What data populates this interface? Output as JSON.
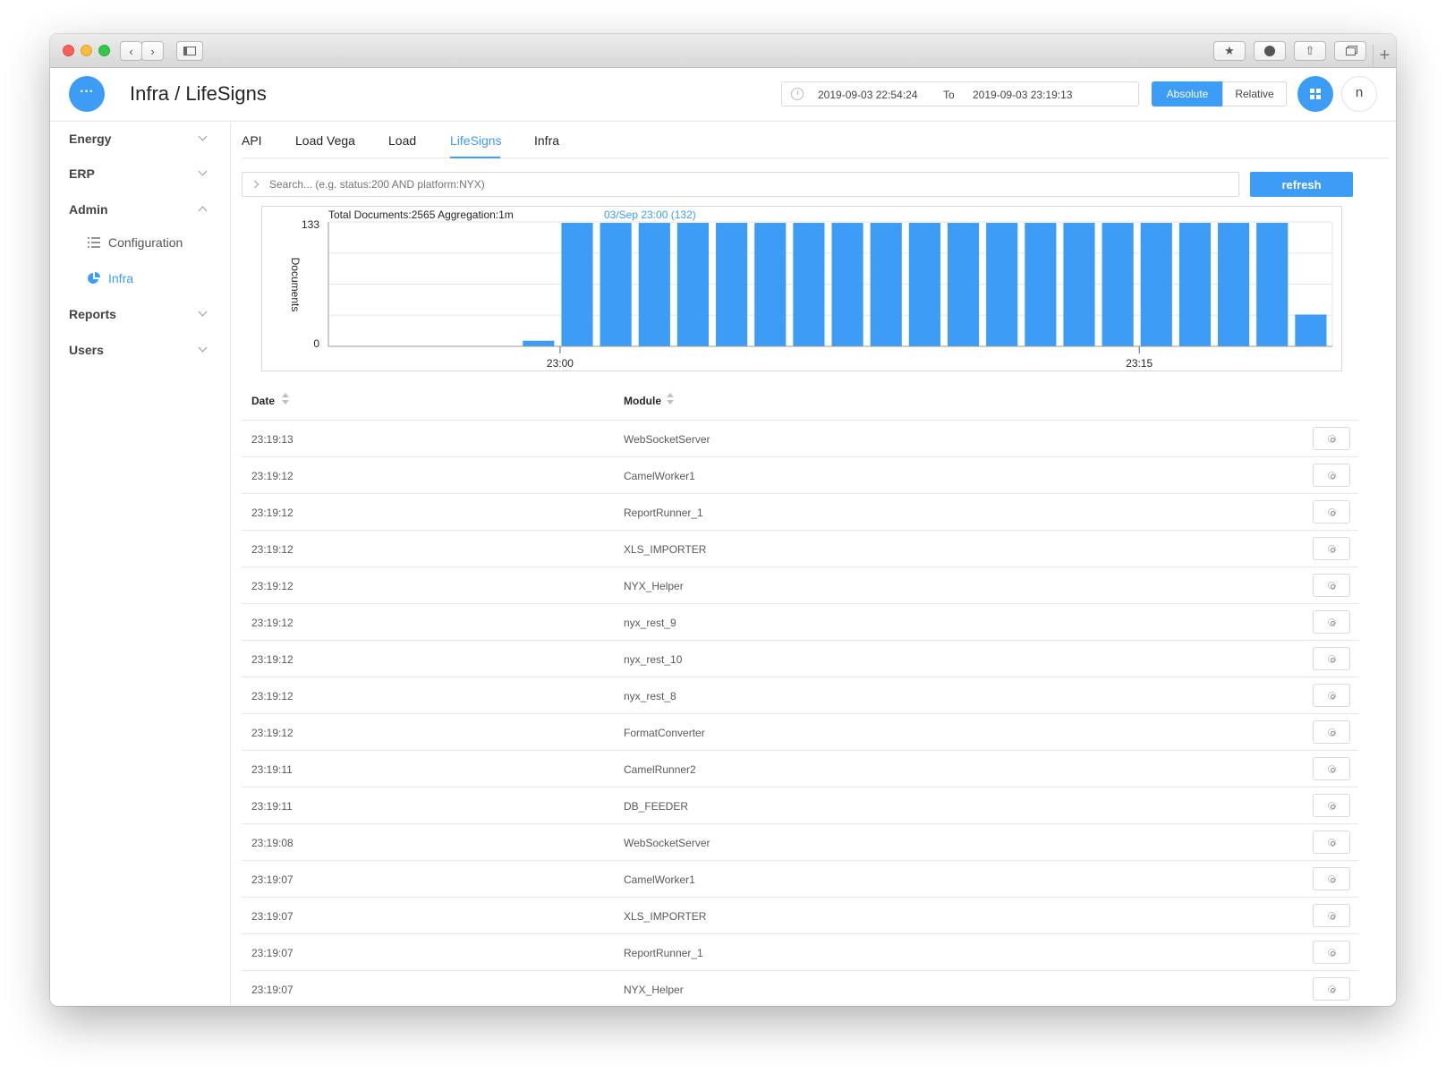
{
  "app": {
    "title": "Infra / LifeSigns"
  },
  "header": {
    "range_from": "2019-09-03 22:54:24",
    "range_to_label": "To",
    "range_to": "2019-09-03 23:19:13",
    "absolute_label": "Absolute",
    "relative_label": "Relative",
    "user_initial": "n",
    "accent_color": "#3d9cf5"
  },
  "sidebar": {
    "groups": [
      {
        "label": "Energy",
        "expanded": false
      },
      {
        "label": "ERP",
        "expanded": false
      },
      {
        "label": "Admin",
        "expanded": true
      },
      {
        "label": "Reports",
        "expanded": false
      },
      {
        "label": "Users",
        "expanded": false
      }
    ],
    "admin_items": [
      {
        "label": "Configuration",
        "icon": "list-icon",
        "active": false
      },
      {
        "label": "Infra",
        "icon": "pie-chart-icon",
        "active": true
      }
    ]
  },
  "tabs": [
    {
      "label": "API",
      "active": false
    },
    {
      "label": "Load Vega",
      "active": false
    },
    {
      "label": "Load",
      "active": false
    },
    {
      "label": "LifeSigns",
      "active": true
    },
    {
      "label": "Infra",
      "active": false
    }
  ],
  "search": {
    "placeholder": "Search... (e.g. status:200 AND platform:NYX)",
    "value": ""
  },
  "refresh_label": "refresh",
  "chart_data": {
    "type": "bar",
    "title": "Total Documents:2565 Aggregation:1m",
    "hover_label": "03/Sep 23:00 (132)",
    "ylabel": "Documents",
    "ylim": [
      0,
      133
    ],
    "y_ticks": [
      0,
      133
    ],
    "x_ticks": [
      "23:00",
      "23:15"
    ],
    "grid": true,
    "bar_color": "#3d9cf5",
    "categories": [
      "22:54",
      "22:55",
      "22:56",
      "22:57",
      "22:58",
      "22:59",
      "23:00",
      "23:01",
      "23:02",
      "23:03",
      "23:04",
      "23:05",
      "23:06",
      "23:07",
      "23:08",
      "23:09",
      "23:10",
      "23:11",
      "23:12",
      "23:13",
      "23:14",
      "23:15",
      "23:16",
      "23:17",
      "23:18",
      "23:19"
    ],
    "values": [
      0,
      0,
      0,
      0,
      0,
      6,
      132,
      132,
      132,
      132,
      132,
      132,
      132,
      132,
      132,
      132,
      132,
      132,
      132,
      132,
      132,
      132,
      132,
      132,
      132,
      34
    ]
  },
  "table": {
    "columns": [
      "Date",
      "Module"
    ],
    "rows": [
      {
        "date": "23:19:13",
        "module": "WebSocketServer"
      },
      {
        "date": "23:19:12",
        "module": "CamelWorker1"
      },
      {
        "date": "23:19:12",
        "module": "ReportRunner_1"
      },
      {
        "date": "23:19:12",
        "module": "XLS_IMPORTER"
      },
      {
        "date": "23:19:12",
        "module": "NYX_Helper"
      },
      {
        "date": "23:19:12",
        "module": "nyx_rest_9"
      },
      {
        "date": "23:19:12",
        "module": "nyx_rest_10"
      },
      {
        "date": "23:19:12",
        "module": "nyx_rest_8"
      },
      {
        "date": "23:19:12",
        "module": "FormatConverter"
      },
      {
        "date": "23:19:11",
        "module": "CamelRunner2"
      },
      {
        "date": "23:19:11",
        "module": "DB_FEEDER"
      },
      {
        "date": "23:19:08",
        "module": "WebSocketServer"
      },
      {
        "date": "23:19:07",
        "module": "CamelWorker1"
      },
      {
        "date": "23:19:07",
        "module": "XLS_IMPORTER"
      },
      {
        "date": "23:19:07",
        "module": "ReportRunner_1"
      },
      {
        "date": "23:19:07",
        "module": "NYX_Helper"
      }
    ]
  }
}
